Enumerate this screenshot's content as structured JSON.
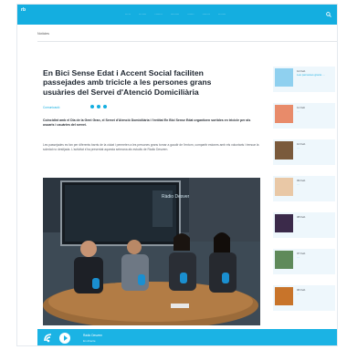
{
  "header": {
    "logo_text": "rb",
    "nav": [
      "·····",
      "·······",
      "·······",
      "········",
      "······",
      "·······",
      "·······"
    ]
  },
  "breadcrumb": "Notícies",
  "article": {
    "kicker": "",
    "headline": "En Bici Sense Edat i Accent Social faciliten passejades amb tricicle a les persones grans usuàries del Servei d'Atenció Domiciliària",
    "byline": "Comunicació",
    "lead": "Coincidint amb el Dia de la Gent Gran, el Servei d'Atenció Domiciliària i l'entitat En Bici Sense Edat organitzen sortides en tricicle per als usuaris i usuàries del servei.",
    "body": "Les passejades es fan per diferents barris de la ciutat i permeten a les persones grans tornar a gaudir de l'entorn, compartir estones amb els voluntaris i trencar la soledat no desitjada. L'activitat s'ha presentat aquesta setmana als estudis de Ràdio Desvern."
  },
  "sidebar": [
    {
      "date": "12 Feb",
      "text": "Les persones grans ..."
    },
    {
      "date": "11 Feb",
      "text": "..."
    },
    {
      "date": "10 Feb",
      "text": "..."
    },
    {
      "date": "09 Feb",
      "text": "..."
    },
    {
      "date": "08 Feb",
      "text": "..."
    },
    {
      "date": "07 Feb",
      "text": "..."
    },
    {
      "date": "06 Feb",
      "text": "..."
    }
  ],
  "player": {
    "title": "Ràdio Desvern",
    "subtitle": "En directe"
  },
  "photo": {
    "studio_sign": "Ràdio Desvern"
  },
  "colors": {
    "brand": "#14aee0",
    "sidebar_bg": "#eef7fc"
  },
  "icons": [
    "search-icon",
    "share-icon",
    "play-icon",
    "logo-icon"
  ]
}
